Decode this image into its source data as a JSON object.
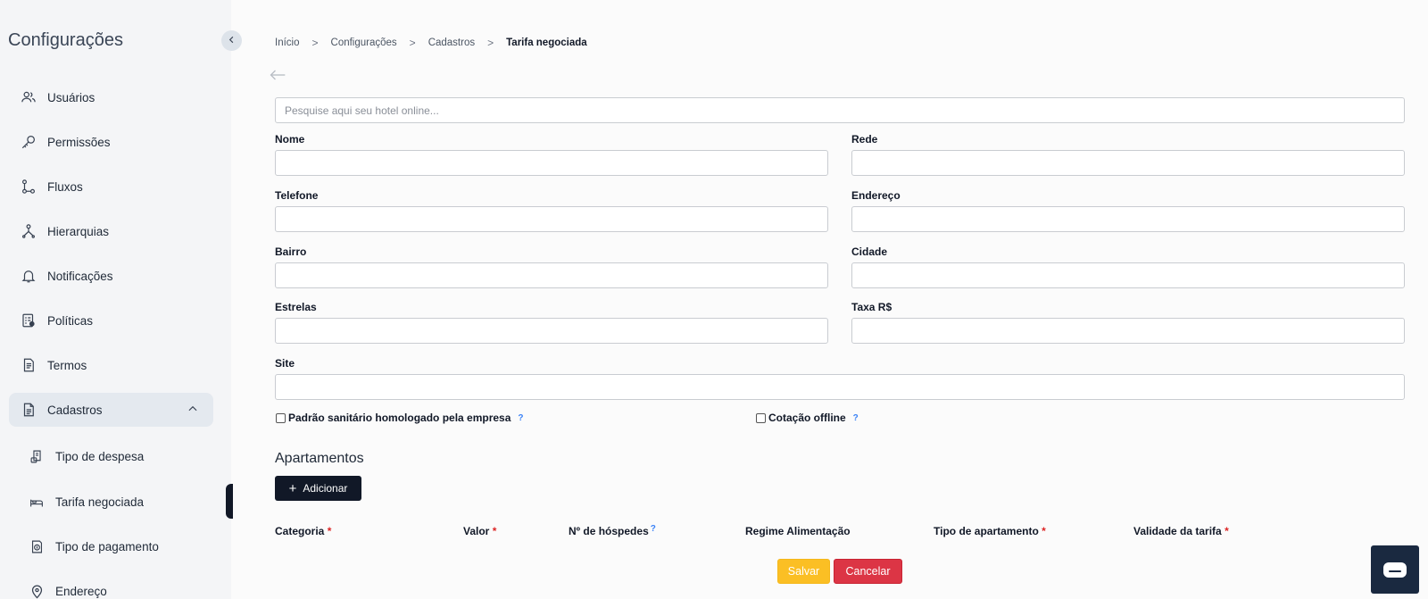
{
  "sidebar": {
    "title": "Configurações",
    "items": [
      {
        "label": "Usuários",
        "icon": "users-icon"
      },
      {
        "label": "Permissões",
        "icon": "key-icon"
      },
      {
        "label": "Fluxos",
        "icon": "flow-icon"
      },
      {
        "label": "Hierarquias",
        "icon": "hierarchy-icon"
      },
      {
        "label": "Notificações",
        "icon": "bell-icon"
      },
      {
        "label": "Políticas",
        "icon": "policy-icon"
      },
      {
        "label": "Termos",
        "icon": "document-icon"
      },
      {
        "label": "Cadastros",
        "icon": "file-icon",
        "expanded": true
      }
    ],
    "subitems": [
      {
        "label": "Tipo de despesa",
        "icon": "receipt-icon"
      },
      {
        "label": "Tarifa negociada",
        "icon": "bed-icon",
        "active": true
      },
      {
        "label": "Tipo de pagamento",
        "icon": "payment-icon"
      },
      {
        "label": "Endereço",
        "icon": "location-icon"
      }
    ]
  },
  "breadcrumb": {
    "items": [
      "Início",
      "Configurações",
      "Cadastros",
      "Tarifa negociada"
    ],
    "separator": ">"
  },
  "search": {
    "placeholder": "Pesquise aqui seu hotel online..."
  },
  "form": {
    "nome": "Nome",
    "rede": "Rede",
    "telefone": "Telefone",
    "endereco": "Endereço",
    "bairro": "Bairro",
    "cidade": "Cidade",
    "estrelas": "Estrelas",
    "taxa": "Taxa R$",
    "site": "Site",
    "padrao_sanitario": "Padrão sanitário homologado pela empresa",
    "cotacao_offline": "Cotação offline",
    "help_glyph": "?"
  },
  "apartamentos": {
    "title": "Apartamentos",
    "add_label": "Adicionar",
    "columns": [
      {
        "label": "Categoria",
        "required": "*"
      },
      {
        "label": "Valor",
        "required": "*"
      },
      {
        "label": "Nº de hóspedes",
        "help": "?"
      },
      {
        "label": "Regime Alimentação"
      },
      {
        "label": "Tipo de apartamento",
        "required": "*"
      },
      {
        "label": "Validade da tarifa",
        "required": "*"
      }
    ]
  },
  "actions": {
    "save": "Salvar",
    "cancel": "Cancelar"
  },
  "colors": {
    "primary": "#111827",
    "save": "#fbbf24",
    "cancel": "#dc3545",
    "help": "#3b82f6",
    "required": "#dc2626"
  }
}
